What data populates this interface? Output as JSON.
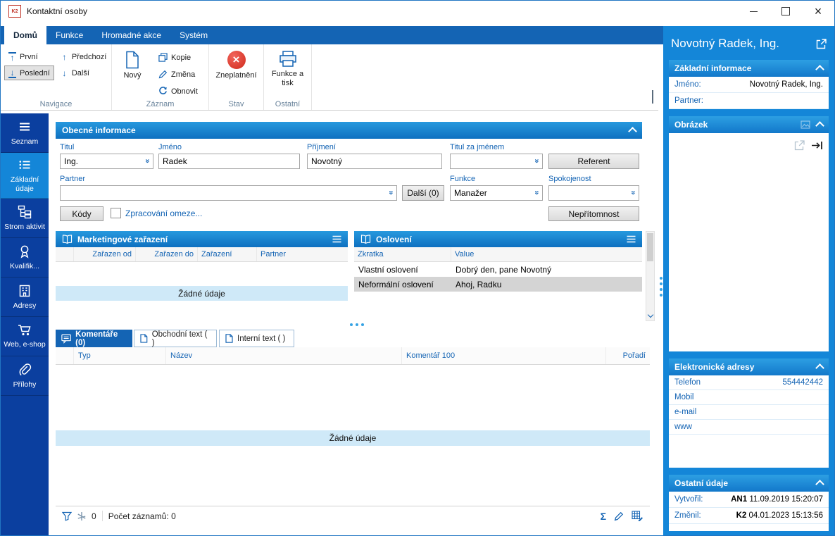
{
  "colors": {
    "accent": "#1464b4",
    "ribbon_bar": "#1464b4",
    "sidebar": "#0b3f9f",
    "right_panel": "#1486d8",
    "section_header": "#1585d6",
    "selected_row": "#d4d4d4",
    "empty_row_highlight": "#cfe9f8",
    "danger": "#d22d1e"
  },
  "icons": {
    "close": "×",
    "dropdown": "«",
    "arrow_up": "↑",
    "arrow_down": "↓",
    "sigma": "Σ",
    "cancel_x": "×"
  },
  "window": {
    "title": "Kontaktní osoby",
    "logo_text": "K2"
  },
  "ribbon": {
    "tabs": [
      {
        "label": "Domů"
      },
      {
        "label": "Funkce"
      },
      {
        "label": "Hromadné akce"
      },
      {
        "label": "Systém"
      }
    ],
    "navigace": {
      "label": "Navigace",
      "prvni": "První",
      "predchozi": "Předchozí",
      "posledni": "Poslední",
      "dalsi": "Další"
    },
    "zaznam": {
      "label": "Záznam",
      "novy": "Nový",
      "kopie": "Kopie",
      "zmena": "Změna",
      "obnovit": "Obnovit"
    },
    "stav": {
      "label": "Stav",
      "zneplatneni": "Zneplatnění"
    },
    "ostatni": {
      "label": "Ostatní",
      "funkce_a_tisk": "Funkce a tisk"
    }
  },
  "sidebar": {
    "items": [
      {
        "label": "Seznam"
      },
      {
        "label": "Základní údaje"
      },
      {
        "label": "Strom aktivit"
      },
      {
        "label": "Kvalifik..."
      },
      {
        "label": "Adresy"
      },
      {
        "label": "Web, e-shop"
      },
      {
        "label": "Přílohy"
      }
    ]
  },
  "general_section": {
    "title": "Obecné informace",
    "titul_label": "Titul",
    "titul_value": "Ing.",
    "jmeno_label": "Jméno",
    "jmeno_value": "Radek",
    "prijmeni_label": "Příjmení",
    "prijmeni_value": "Novotný",
    "titul_za_label": "Titul za jménem",
    "titul_za_value": "",
    "referent_button": "Referent",
    "partner_label": "Partner",
    "partner_value": "",
    "dalsi_button": "Další (0)",
    "funkce_label": "Funkce",
    "funkce_value": "Manažer",
    "spokojenost_label": "Spokojenost",
    "spokojenost_value": "",
    "kody_button": "Kódy",
    "zpracovani_checkbox_label": "Zpracování omeze...",
    "nepritomnost_button": "Nepřítomnost"
  },
  "marketing_panel": {
    "title": "Marketingové zařazení",
    "columns": [
      "Zařazen od",
      "Zařazen do",
      "Zařazení",
      "Partner"
    ],
    "empty_text": "Žádné údaje"
  },
  "osloveni_panel": {
    "title": "Oslovení",
    "columns": [
      "Zkratka",
      "Value"
    ],
    "rows": [
      {
        "zkratka": "Vlastní oslovení",
        "value": "Dobrý den, pane Novotný"
      },
      {
        "zkratka": "Neformální oslovení",
        "value": "Ahoj, Radku"
      }
    ]
  },
  "bottom_tabs": [
    {
      "label": "Komentáře (0)"
    },
    {
      "label": "Obchodní text ( )"
    },
    {
      "label": "Interní text ( )"
    }
  ],
  "comments_table": {
    "columns": [
      "Typ",
      "Název",
      "Komentář 100",
      "Pořadí"
    ],
    "empty_text": "Žádné údaje"
  },
  "status_bar": {
    "filter_count": "0",
    "records_label": "Počet záznamů: 0"
  },
  "right_panel": {
    "title": "Novotný Radek, Ing.",
    "zakladni": {
      "title": "Základní informace",
      "jmeno_label": "Jméno:",
      "jmeno_value": "Novotný Radek, Ing.",
      "partner_label": "Partner:",
      "partner_value": ""
    },
    "obrazek": {
      "title": "Obrázek"
    },
    "adresy": {
      "title": "Elektronické adresy",
      "rows": [
        {
          "label": "Telefon",
          "value": "554442442"
        },
        {
          "label": "Mobil",
          "value": ""
        },
        {
          "label": "e-mail",
          "value": ""
        },
        {
          "label": "www",
          "value": ""
        }
      ]
    },
    "ostatni": {
      "title": "Ostatní údaje",
      "vytvoril_label": "Vytvořil:",
      "vytvoril_user": "AN1",
      "vytvoril_time": "11.09.2019 15:20:07",
      "zmenil_label": "Změnil:",
      "zmenil_user": "K2",
      "zmenil_time": "04.01.2023 15:13:56"
    }
  }
}
